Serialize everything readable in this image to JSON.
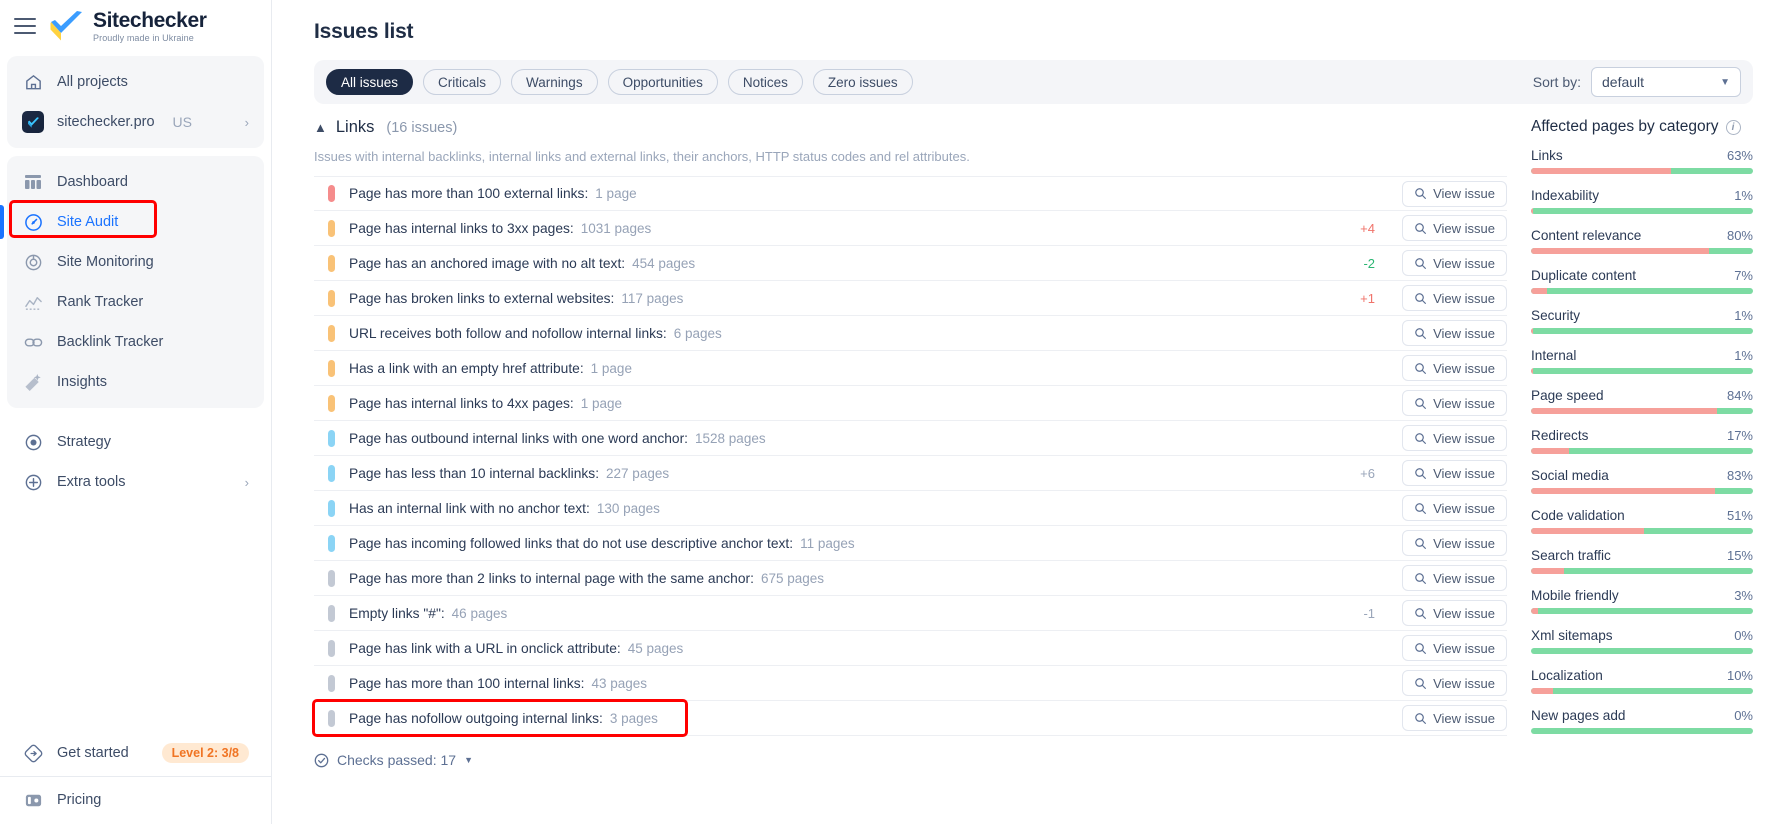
{
  "brand": {
    "name": "Sitechecker",
    "tagline": "Proudly made in Ukraine"
  },
  "sidebar": {
    "top_items": [
      {
        "label": "All projects",
        "icon": "home-icon"
      },
      {
        "label": "sitechecker.pro",
        "suffix": "US",
        "icon": "project-avatar",
        "chevron": "›"
      }
    ],
    "main_items": [
      {
        "label": "Dashboard",
        "icon": "dashboard-icon",
        "active": false
      },
      {
        "label": "Site Audit",
        "icon": "site-audit-icon",
        "active": true
      },
      {
        "label": "Site Monitoring",
        "icon": "site-monitoring-icon",
        "active": false
      },
      {
        "label": "Rank Tracker",
        "icon": "rank-tracker-icon",
        "active": false
      },
      {
        "label": "Backlink Tracker",
        "icon": "backlink-tracker-icon",
        "active": false
      },
      {
        "label": "Insights",
        "icon": "insights-icon",
        "active": false
      }
    ],
    "secondary_items": [
      {
        "label": "Strategy",
        "icon": "strategy-icon",
        "chevron": ""
      },
      {
        "label": "Extra tools",
        "icon": "extra-tools-icon",
        "chevron": "›"
      }
    ],
    "bottom_items": [
      {
        "label": "Get started",
        "icon": "get-started-icon",
        "badge": "Level 2: 3/8"
      },
      {
        "label": "Pricing",
        "icon": "pricing-icon",
        "badge": ""
      }
    ]
  },
  "header": {
    "title": "Issues list"
  },
  "toolbar": {
    "filters": [
      {
        "label": "All issues",
        "active": true
      },
      {
        "label": "Criticals",
        "active": false
      },
      {
        "label": "Warnings",
        "active": false
      },
      {
        "label": "Opportunities",
        "active": false
      },
      {
        "label": "Notices",
        "active": false
      },
      {
        "label": "Zero issues",
        "active": false
      }
    ],
    "sort_label": "Sort by:",
    "sort_value": "default"
  },
  "section": {
    "title": "Links",
    "count": "(16 issues)",
    "description": "Issues with internal backlinks, internal links and external links, their anchors, HTTP status codes and rel attributes.",
    "view_issue_label": "View issue",
    "checks_passed": "Checks passed: 17"
  },
  "issues": [
    {
      "severity": "critical",
      "name": "Page has more than 100 external links",
      "count": "1 page",
      "delta": "",
      "delta_dir": ""
    },
    {
      "severity": "warning",
      "name": "Page has internal links to 3xx pages",
      "count": "1031 pages",
      "delta": "+4",
      "delta_dir": "up"
    },
    {
      "severity": "warning",
      "name": "Page has an anchored image with no alt text",
      "count": "454 pages",
      "delta": "-2",
      "delta_dir": "down"
    },
    {
      "severity": "warning",
      "name": "Page has broken links to external websites",
      "count": "117 pages",
      "delta": "+1",
      "delta_dir": "up"
    },
    {
      "severity": "warning",
      "name": "URL receives both follow and nofollow internal links",
      "count": "6 pages",
      "delta": "",
      "delta_dir": ""
    },
    {
      "severity": "warning",
      "name": "Has a link with an empty href attribute",
      "count": "1 page",
      "delta": "",
      "delta_dir": ""
    },
    {
      "severity": "warning",
      "name": "Page has internal links to 4xx pages",
      "count": "1 page",
      "delta": "",
      "delta_dir": ""
    },
    {
      "severity": "opportunity",
      "name": "Page has outbound internal links with one word anchor",
      "count": "1528 pages",
      "delta": "",
      "delta_dir": ""
    },
    {
      "severity": "opportunity",
      "name": "Page has less than 10 internal backlinks",
      "count": "227 pages",
      "delta": "+6",
      "delta_dir": "neutral"
    },
    {
      "severity": "opportunity",
      "name": "Has an internal link with no anchor text",
      "count": "130 pages",
      "delta": "",
      "delta_dir": ""
    },
    {
      "severity": "opportunity",
      "name": "Page has incoming followed links that do not use descriptive anchor text",
      "count": "11 pages",
      "delta": "",
      "delta_dir": ""
    },
    {
      "severity": "notice",
      "name": "Page has more than 2 links to internal page with the same anchor",
      "count": "675 pages",
      "delta": "",
      "delta_dir": ""
    },
    {
      "severity": "notice",
      "name": "Empty links \"#\"",
      "count": "46 pages",
      "delta": "-1",
      "delta_dir": "neutral"
    },
    {
      "severity": "notice",
      "name": "Page has link with a URL in onclick attribute",
      "count": "45 pages",
      "delta": "",
      "delta_dir": ""
    },
    {
      "severity": "notice",
      "name": "Page has more than 100 internal links",
      "count": "43 pages",
      "delta": "",
      "delta_dir": ""
    },
    {
      "severity": "notice",
      "name": "Page has nofollow outgoing internal links",
      "count": "3 pages",
      "delta": "",
      "delta_dir": ""
    }
  ],
  "affected_panel": {
    "title": "Affected pages by category",
    "categories": [
      {
        "label": "Links",
        "percent": 63,
        "percent_label": "63%"
      },
      {
        "label": "Indexability",
        "percent": 1,
        "percent_label": "1%"
      },
      {
        "label": "Content relevance",
        "percent": 80,
        "percent_label": "80%"
      },
      {
        "label": "Duplicate content",
        "percent": 7,
        "percent_label": "7%"
      },
      {
        "label": "Security",
        "percent": 1,
        "percent_label": "1%"
      },
      {
        "label": "Internal",
        "percent": 1,
        "percent_label": "1%"
      },
      {
        "label": "Page speed",
        "percent": 84,
        "percent_label": "84%"
      },
      {
        "label": "Redirects",
        "percent": 17,
        "percent_label": "17%"
      },
      {
        "label": "Social media",
        "percent": 83,
        "percent_label": "83%"
      },
      {
        "label": "Code validation",
        "percent": 51,
        "percent_label": "51%"
      },
      {
        "label": "Search traffic",
        "percent": 15,
        "percent_label": "15%"
      },
      {
        "label": "Mobile friendly",
        "percent": 3,
        "percent_label": "3%"
      },
      {
        "label": "Xml sitemaps",
        "percent": 0,
        "percent_label": "0%"
      },
      {
        "label": "Localization",
        "percent": 10,
        "percent_label": "10%"
      },
      {
        "label": "New pages add",
        "percent": 0,
        "percent_label": "0%"
      }
    ]
  },
  "colors": {
    "accent": "#1a73ff",
    "critical": "#f58c8c",
    "warning": "#f9c277",
    "opportunity": "#8bd4f5",
    "notice": "#c3c9d4",
    "bar_affected": "#f6a09a",
    "bar_ok": "#7ddba3",
    "highlight": "#ff0000",
    "badge_bg": "#ffe9d2",
    "badge_text": "#f07423"
  }
}
